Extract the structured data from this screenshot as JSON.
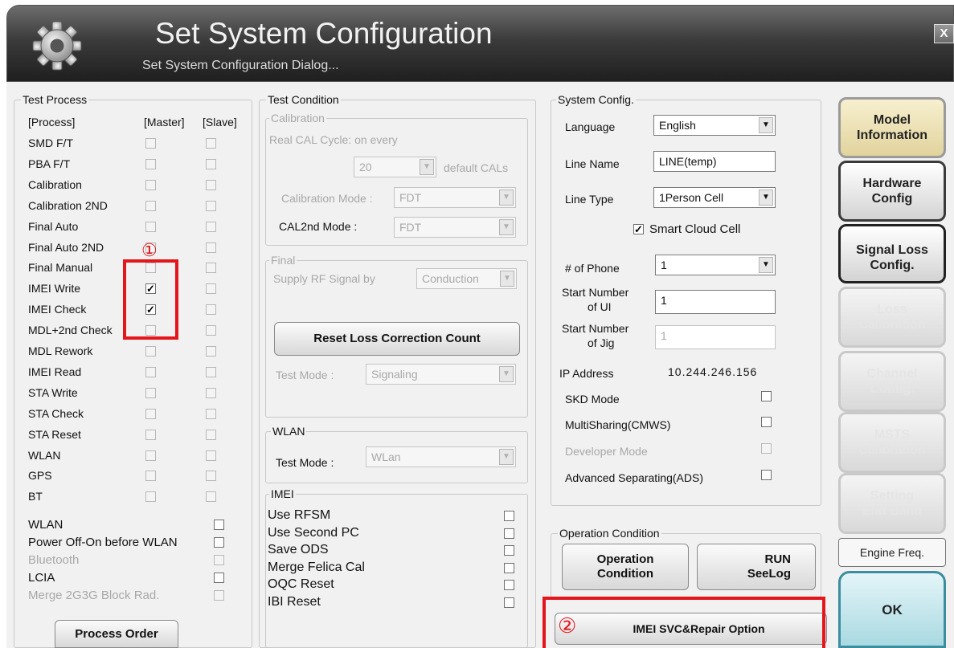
{
  "window": {
    "title": "Set System Configuration",
    "subtitle": "Set System Configuration Dialog...",
    "close_label": "X"
  },
  "test_process": {
    "legend": "Test Process",
    "col_process": "[Process]",
    "col_master": "[Master]",
    "col_slave": "[Slave]",
    "rows": [
      {
        "label": "SMD F/T",
        "master": false,
        "slave": false
      },
      {
        "label": "PBA F/T",
        "master": false,
        "slave": false
      },
      {
        "label": "Calibration",
        "master": false,
        "slave": false
      },
      {
        "label": "Calibration 2ND",
        "master": false,
        "slave": false
      },
      {
        "label": "Final Auto",
        "master": false,
        "slave": false
      },
      {
        "label": "Final Auto 2ND",
        "master": false,
        "slave": false
      },
      {
        "label": "Final Manual",
        "master": false,
        "slave": false
      },
      {
        "label": "IMEI Write",
        "master": true,
        "slave": false
      },
      {
        "label": "IMEI Check",
        "master": true,
        "slave": false
      },
      {
        "label": "MDL+2nd Check",
        "master": false,
        "slave": false
      },
      {
        "label": "MDL Rework",
        "master": false,
        "slave": false
      },
      {
        "label": "IMEI Read",
        "master": false,
        "slave": false
      },
      {
        "label": "STA Write",
        "master": false,
        "slave": false
      },
      {
        "label": "STA Check",
        "master": false,
        "slave": false
      },
      {
        "label": "STA Reset",
        "master": false,
        "slave": false
      },
      {
        "label": "WLAN",
        "master": false,
        "slave": false
      },
      {
        "label": "GPS",
        "master": false,
        "slave": false
      },
      {
        "label": "BT",
        "master": false,
        "slave": false
      }
    ],
    "extra_options": [
      {
        "label": "WLAN",
        "checked": false,
        "disabled": false
      },
      {
        "label": "Power Off-On before WLAN",
        "checked": false,
        "disabled": false
      },
      {
        "label": "Bluetooth",
        "checked": false,
        "disabled": true
      },
      {
        "label": "LCIA",
        "checked": false,
        "disabled": false
      },
      {
        "label": "Merge 2G3G Block Rad.",
        "checked": false,
        "disabled": true
      }
    ],
    "process_order_label": "Process Order",
    "annotation_1": "①"
  },
  "test_condition": {
    "legend": "Test Condition",
    "calibration": {
      "legend": "Calibration",
      "cycle_label": "Real CAL Cycle: on every",
      "cycle_value": "20",
      "cycle_suffix": "default CALs",
      "mode_label": "Calibration Mode :",
      "mode_value": "FDT",
      "mode2_label": "CAL2nd Mode :",
      "mode2_value": "FDT"
    },
    "final": {
      "legend": "Final",
      "supply_label": "Supply RF Signal by",
      "supply_value": "Conduction",
      "reset_button": "Reset Loss Correction Count",
      "test_mode_label": "Test Mode :",
      "test_mode_value": "Signaling"
    },
    "wlan": {
      "legend": "WLAN",
      "test_mode_label": "Test Mode :",
      "test_mode_value": "WLan"
    },
    "imei": {
      "legend": "IMEI",
      "options": [
        {
          "label": "Use RFSM",
          "checked": false
        },
        {
          "label": "Use Second PC",
          "checked": false
        },
        {
          "label": "Save ODS",
          "checked": false
        },
        {
          "label": "Merge Felica Cal",
          "checked": false
        },
        {
          "label": "OQC Reset",
          "checked": false
        },
        {
          "label": "IBI Reset",
          "checked": false
        }
      ]
    }
  },
  "system_config": {
    "legend": "System Config.",
    "language_label": "Language",
    "language_value": "English",
    "line_name_label": "Line Name",
    "line_name_value": "LINE(temp)",
    "line_type_label": "Line Type",
    "line_type_value": "1Person Cell",
    "smart_cloud_label": "Smart Cloud Cell",
    "smart_cloud_checked": true,
    "phone_count_label": "# of Phone",
    "phone_count_value": "1",
    "start_ui_label_1": "Start Number",
    "start_ui_label_2": "of UI",
    "start_ui_value": "1",
    "start_jig_label_1": "Start Number",
    "start_jig_label_2": "of Jig",
    "start_jig_value": "1",
    "ip_label": "IP Address",
    "ip_value": "10.244.246.156",
    "options": [
      {
        "label": "SKD Mode",
        "checked": false,
        "disabled": false
      },
      {
        "label": "MultiSharing(CMWS)",
        "checked": false,
        "disabled": false
      },
      {
        "label": "Developer Mode",
        "checked": false,
        "disabled": true
      },
      {
        "label": "Advanced Separating(ADS)",
        "checked": false,
        "disabled": false
      }
    ]
  },
  "operation_condition": {
    "legend": "Operation Condition",
    "op_button_1": "Operation",
    "op_button_2": "Condition",
    "run_button_1": "RUN",
    "run_button_2": "SeeLog"
  },
  "imei_svc_button": "IMEI SVC&Repair Option",
  "annotation_2": "②",
  "side_buttons": {
    "model_1": "Model",
    "model_2": "Information",
    "hardware_1": "Hardware",
    "hardware_2": "Config",
    "signal_loss_1": "Signal Loss",
    "signal_loss_2": "Config.",
    "loss_cal_1": "Loss",
    "loss_cal_2": "Calibration",
    "channel_1": "Channel",
    "channel_2": "Config.",
    "msts_1": "MSTS",
    "msts_2": "Calibration",
    "setting_1": "Setting",
    "setting_2": "End Band",
    "engine_freq": "Engine Freq.",
    "ok": "OK"
  },
  "colors": {
    "annotation_red": "#e3161b",
    "header_dark": "#2a2a2a",
    "ok_accent": "#3b8da0",
    "model_gold": "#e2d39d"
  },
  "icons": {
    "header_icon": "gear-icon"
  }
}
